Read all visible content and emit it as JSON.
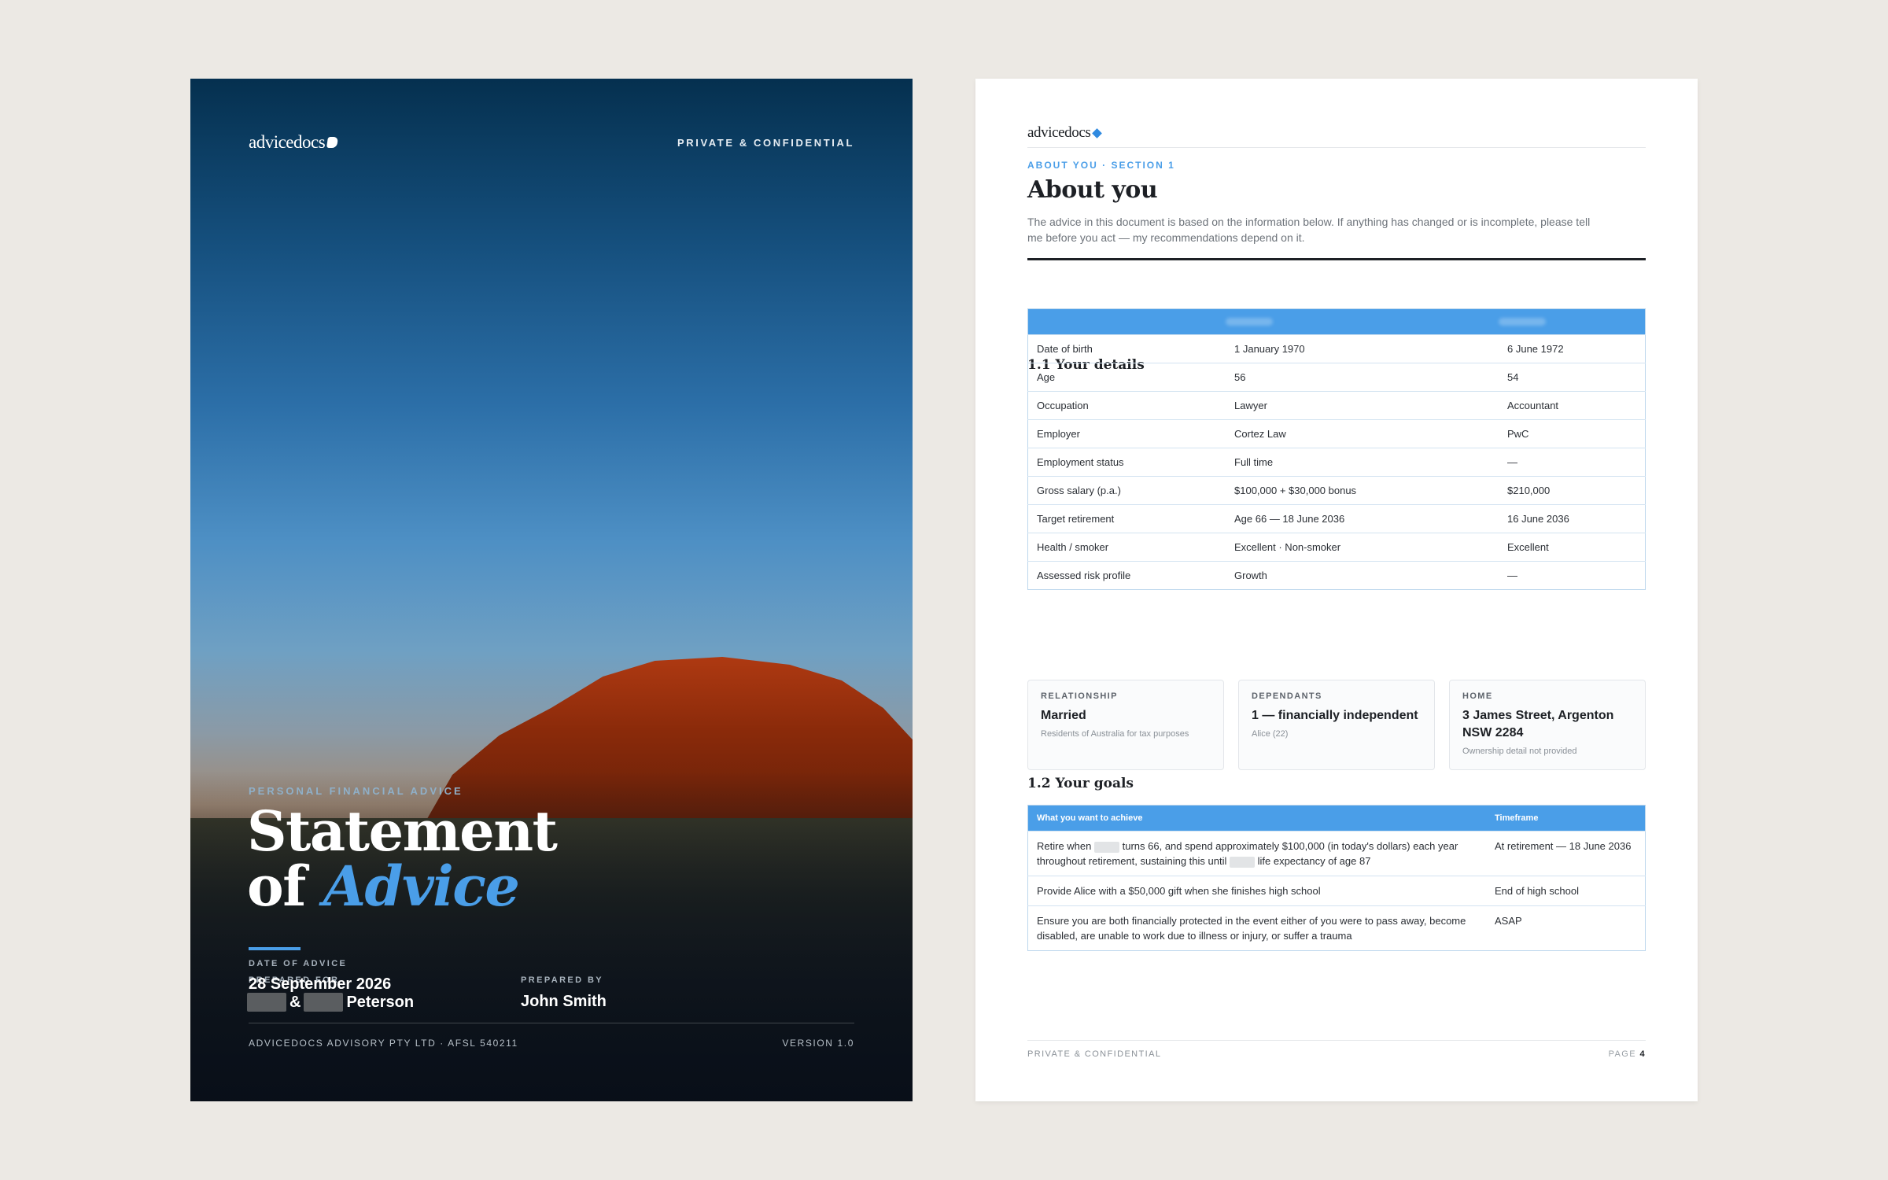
{
  "cover": {
    "logo": "advicedocs",
    "confidential": "PRIVATE & CONFIDENTIAL",
    "kicker": "PERSONAL FINANCIAL ADVICE",
    "title_line1": "Statement",
    "title_of": "of",
    "title_accent": "Advice",
    "prepared_for_label": "PREPARED FOR",
    "prepared_for_amp": "&",
    "prepared_for_surname": "Peterson",
    "prepared_by_label": "PREPARED BY",
    "prepared_by": "John Smith",
    "date_label": "DATE OF ADVICE",
    "date": "28 September 2026",
    "footer_left": "ADVICEDOCS ADVISORY PTY LTD · AFSL 540211",
    "footer_right": "VERSION 1.0"
  },
  "page": {
    "logo": "advicedocs",
    "section": "ABOUT YOU · SECTION 1",
    "heading": "About you",
    "intro": "The advice in this document is based on the information below. If anything has changed or is incomplete, please tell me before you act — my recommendations depend on it.",
    "details_heading": "1.1 Your details",
    "details_rows": [
      {
        "label": "Date of birth",
        "a": "1 January 1970",
        "b": "6 June 1972"
      },
      {
        "label": "Age",
        "a": "56",
        "b": "54"
      },
      {
        "label": "Occupation",
        "a": "Lawyer",
        "b": "Accountant"
      },
      {
        "label": "Employer",
        "a": "Cortez Law",
        "b": "PwC"
      },
      {
        "label": "Employment status",
        "a": "Full time",
        "b": "—"
      },
      {
        "label": "Gross salary (p.a.)",
        "a": "$100,000 + $30,000 bonus",
        "b": "$210,000"
      },
      {
        "label": "Target retirement",
        "a": "Age 66 — 18 June 2036",
        "b": "16 June 2036"
      },
      {
        "label": "Health / smoker",
        "a": "Excellent · Non-smoker",
        "b": "Excellent"
      },
      {
        "label": "Assessed risk profile",
        "a": "Growth",
        "b": "—"
      }
    ],
    "cards": [
      {
        "label": "RELATIONSHIP",
        "value": "Married",
        "sub": "Residents of Australia for tax purposes"
      },
      {
        "label": "DEPENDANTS",
        "value": "1 — financially independent",
        "sub": "Alice (22)"
      },
      {
        "label": "HOME",
        "value": "3 James Street, Argenton NSW 2284",
        "sub": "Ownership detail not provided"
      }
    ],
    "goals_heading": "1.2 Your goals",
    "goals_header": {
      "col1": "What you want to achieve",
      "col2": "Timeframe"
    },
    "goal1": {
      "pre": "Retire when",
      "mid1": "turns 66, and spend approximately $100,000 (in today's dollars) each year throughout retirement, sustaining this until",
      "mid2": "life expectancy of age 87",
      "timeframe": "At retirement — 18 June 2036"
    },
    "goal2": {
      "text": "Provide Alice with a $50,000 gift when she finishes high school",
      "timeframe": "End of high school"
    },
    "goal3": {
      "text": "Ensure you are both financially protected in the event either of you were to pass away, become disabled, are unable to work due to illness or injury, or suffer a trauma",
      "timeframe": "ASAP"
    },
    "footer_left": "PRIVATE & CONFIDENTIAL",
    "footer_page_label": "PAGE",
    "footer_page_num": "4"
  }
}
